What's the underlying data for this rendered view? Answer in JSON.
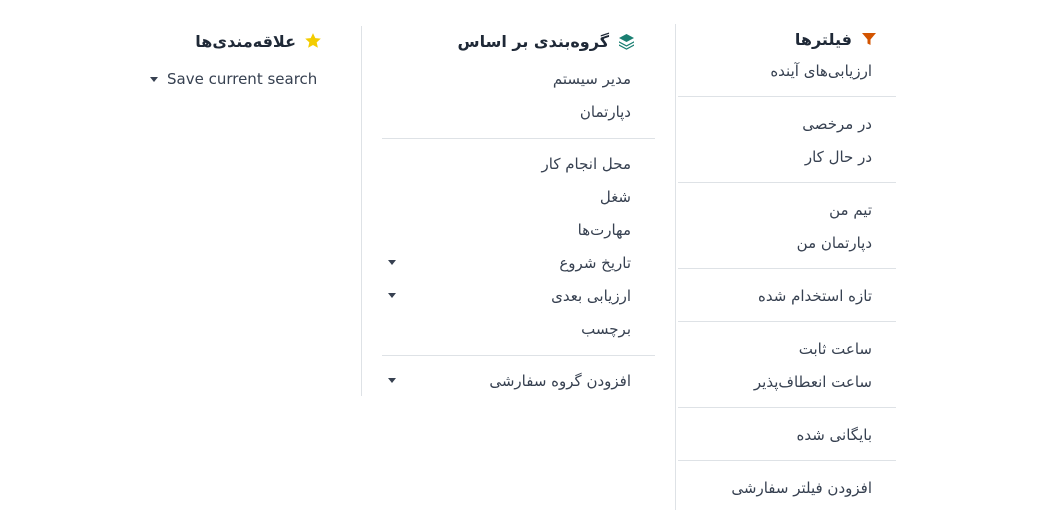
{
  "filters": {
    "title": "فیلترها",
    "icon": "filter-icon",
    "icon_color": "#d35400",
    "groups": [
      [
        "ارزیابی‌های آینده"
      ],
      [
        "در مرخصی",
        "در حال کار"
      ],
      [
        "تیم من",
        "دپارتمان من"
      ],
      [
        "تازه استخدام شده"
      ],
      [
        "ساعت ثابت",
        "ساعت انعطاف‌پذیر"
      ],
      [
        "بایگانی شده"
      ],
      [
        "افزودن فیلتر سفارشی"
      ]
    ]
  },
  "groupby": {
    "title": "گروه‌بندی بر اساس",
    "icon": "layers-icon",
    "icon_color": "#1a7f72",
    "section1": [
      "مدیر سیستم",
      "دپارتمان"
    ],
    "section2": [
      {
        "label": "محل انجام کار",
        "caret": false
      },
      {
        "label": "شغل",
        "caret": false
      },
      {
        "label": "مهارت‌ها",
        "caret": false
      },
      {
        "label": "تاریخ شروع",
        "caret": true
      },
      {
        "label": "ارزیابی بعدی",
        "caret": true
      },
      {
        "label": "برچسب",
        "caret": false
      }
    ],
    "custom": "افزودن گروه سفارشی"
  },
  "favorites": {
    "title": "علاقه‌مندی‌ها",
    "icon": "star-icon",
    "icon_color": "#f3cc00",
    "save_label": "Save current search"
  }
}
